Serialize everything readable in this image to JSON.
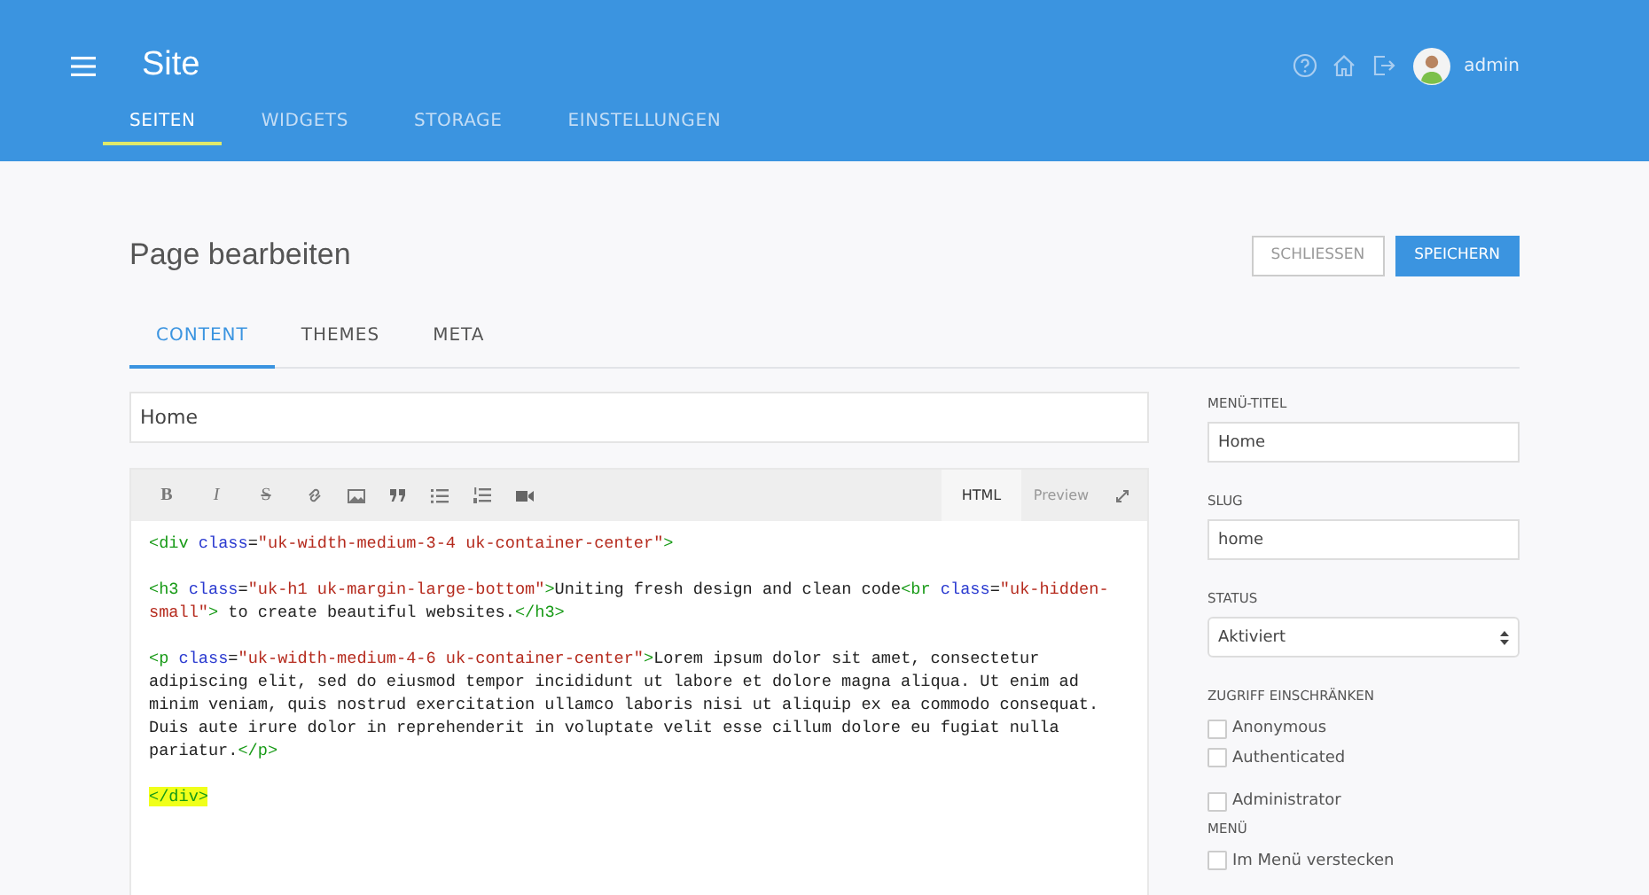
{
  "header": {
    "title": "Site",
    "user": "admin"
  },
  "nav": [
    {
      "label": "SEITEN",
      "selected": true
    },
    {
      "label": "WIDGETS",
      "selected": false
    },
    {
      "label": "STORAGE",
      "selected": false
    },
    {
      "label": "EINSTELLUNGEN",
      "selected": false
    }
  ],
  "page": {
    "title": "Page bearbeiten",
    "buttons": [
      {
        "label": "SCHLIESSEN",
        "kind": "secondary"
      },
      {
        "label": "SPEICHERN",
        "kind": "primary"
      }
    ]
  },
  "tabs": [
    {
      "label": "CONTENT",
      "selected": true
    },
    {
      "label": "THEMES",
      "selected": false
    },
    {
      "label": "META",
      "selected": false
    }
  ],
  "title_field": {
    "value": "Home"
  },
  "editor": {
    "format_buttons": [
      "B",
      "I",
      "S"
    ],
    "modes": [
      {
        "label": "HTML",
        "selected": true
      },
      {
        "label": "Preview",
        "selected": false
      }
    ],
    "blocks": [
      {
        "highlighted": false,
        "tokens": [
          {
            "kind": "tag",
            "text": "<div "
          },
          {
            "kind": "attr",
            "text": "class"
          },
          {
            "kind": "text",
            "text": "="
          },
          {
            "kind": "str",
            "text": "\"uk-width-medium-3-4 uk-container-center\""
          },
          {
            "kind": "tag",
            "text": ">"
          }
        ]
      },
      {
        "highlighted": false,
        "tokens": [
          {
            "kind": "tag",
            "text": "<h3 "
          },
          {
            "kind": "attr",
            "text": "class"
          },
          {
            "kind": "text",
            "text": "="
          },
          {
            "kind": "str",
            "text": "\"uk-h1 uk-margin-large-bottom\""
          },
          {
            "kind": "tag",
            "text": ">"
          },
          {
            "kind": "text",
            "text": "Uniting fresh design and clean code"
          },
          {
            "kind": "tag",
            "text": "<br "
          },
          {
            "kind": "attr",
            "text": "class"
          },
          {
            "kind": "text",
            "text": "="
          },
          {
            "kind": "str",
            "text": "\"uk-hidden-small\""
          },
          {
            "kind": "tag",
            "text": ">"
          },
          {
            "kind": "text",
            "text": " to create beautiful websites."
          },
          {
            "kind": "tag",
            "text": "</h3>"
          }
        ]
      },
      {
        "highlighted": false,
        "tokens": [
          {
            "kind": "tag",
            "text": "<p "
          },
          {
            "kind": "attr",
            "text": "class"
          },
          {
            "kind": "text",
            "text": "="
          },
          {
            "kind": "str",
            "text": "\"uk-width-medium-4-6 uk-container-center\""
          },
          {
            "kind": "tag",
            "text": ">"
          },
          {
            "kind": "text",
            "text": "Lorem ipsum dolor sit amet, consectetur adipiscing elit, sed do eiusmod tempor incididunt ut labore et dolore magna aliqua. Ut enim ad minim veniam, quis nostrud exercitation ullamco laboris nisi ut aliquip ex ea commodo consequat. Duis aute irure dolor in reprehenderit in voluptate velit esse cillum dolore eu fugiat nulla pariatur."
          },
          {
            "kind": "tag",
            "text": "</p>"
          }
        ]
      },
      {
        "highlighted": true,
        "tokens": [
          {
            "kind": "tag",
            "text": "</div>"
          }
        ]
      }
    ]
  },
  "sidebar": {
    "menu_title": {
      "label": "MENÜ-TITEL",
      "value": "Home"
    },
    "slug": {
      "label": "SLUG",
      "value": "home"
    },
    "status": {
      "label": "STATUS",
      "value": "Aktiviert"
    },
    "access": {
      "label": "ZUGRIFF EINSCHRÄNKEN",
      "options": [
        {
          "label": "Anonymous",
          "checked": false
        },
        {
          "label": "Authenticated",
          "checked": false
        },
        {
          "label": "Administrator",
          "checked": false
        }
      ]
    },
    "menu": {
      "label": "MENÜ",
      "options": [
        {
          "label": "Im Menü verstecken",
          "checked": false
        }
      ]
    }
  }
}
